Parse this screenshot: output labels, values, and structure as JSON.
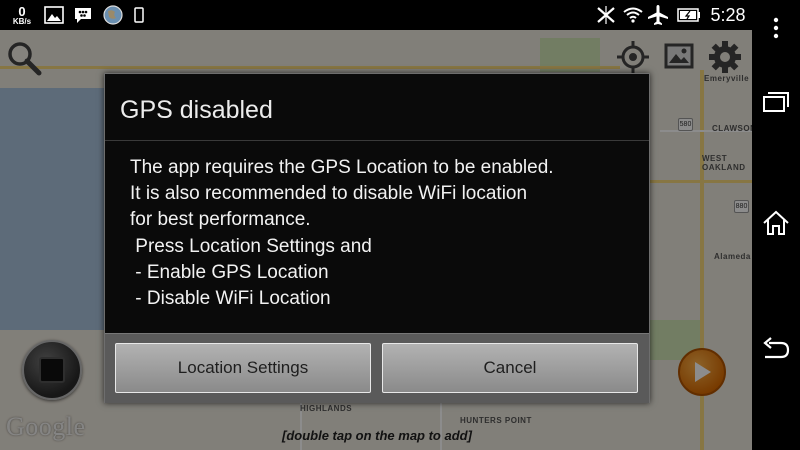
{
  "statusbar": {
    "data_speed": "0",
    "data_unit": "KB/s",
    "time": "5:28"
  },
  "map": {
    "attribution": "Google",
    "hint": "[double tap on the map to add]",
    "labels": {
      "emeryville": "Emeryville",
      "clawson": "CLAWSON",
      "west_oakland": "WEST OAKLAND",
      "alameda": "Alameda",
      "highlands": "HIGHLANDS",
      "hunters_point": "HUNTERS POINT"
    },
    "shields": [
      "580",
      "880"
    ]
  },
  "dialog": {
    "title": "GPS disabled",
    "message": "The app requires the GPS Location to be enabled.\nIt is also recommended to disable WiFi location\nfor best performance.\n Press Location Settings and\n - Enable GPS Location\n - Disable WiFi Location",
    "buttons": {
      "location_settings": "Location Settings",
      "cancel": "Cancel"
    }
  },
  "colors": {
    "dialog_bg": "#0a0a0a",
    "button_gray": "#a0a0a0",
    "play_orange": "#e77b10",
    "water": "#a9c3dc"
  },
  "icons": {
    "statusbar": [
      "image-icon",
      "bbm-icon",
      "globe-icon",
      "phone-icon",
      "vibrate-off-icon",
      "wifi-icon",
      "airplane-icon",
      "battery-icon"
    ],
    "navbar": [
      "menu-icon",
      "recent-apps-icon",
      "home-icon",
      "back-icon"
    ],
    "map": [
      "search-icon",
      "gps-target-icon",
      "map-layers-icon",
      "gear-icon",
      "stop-icon",
      "play-icon"
    ]
  }
}
